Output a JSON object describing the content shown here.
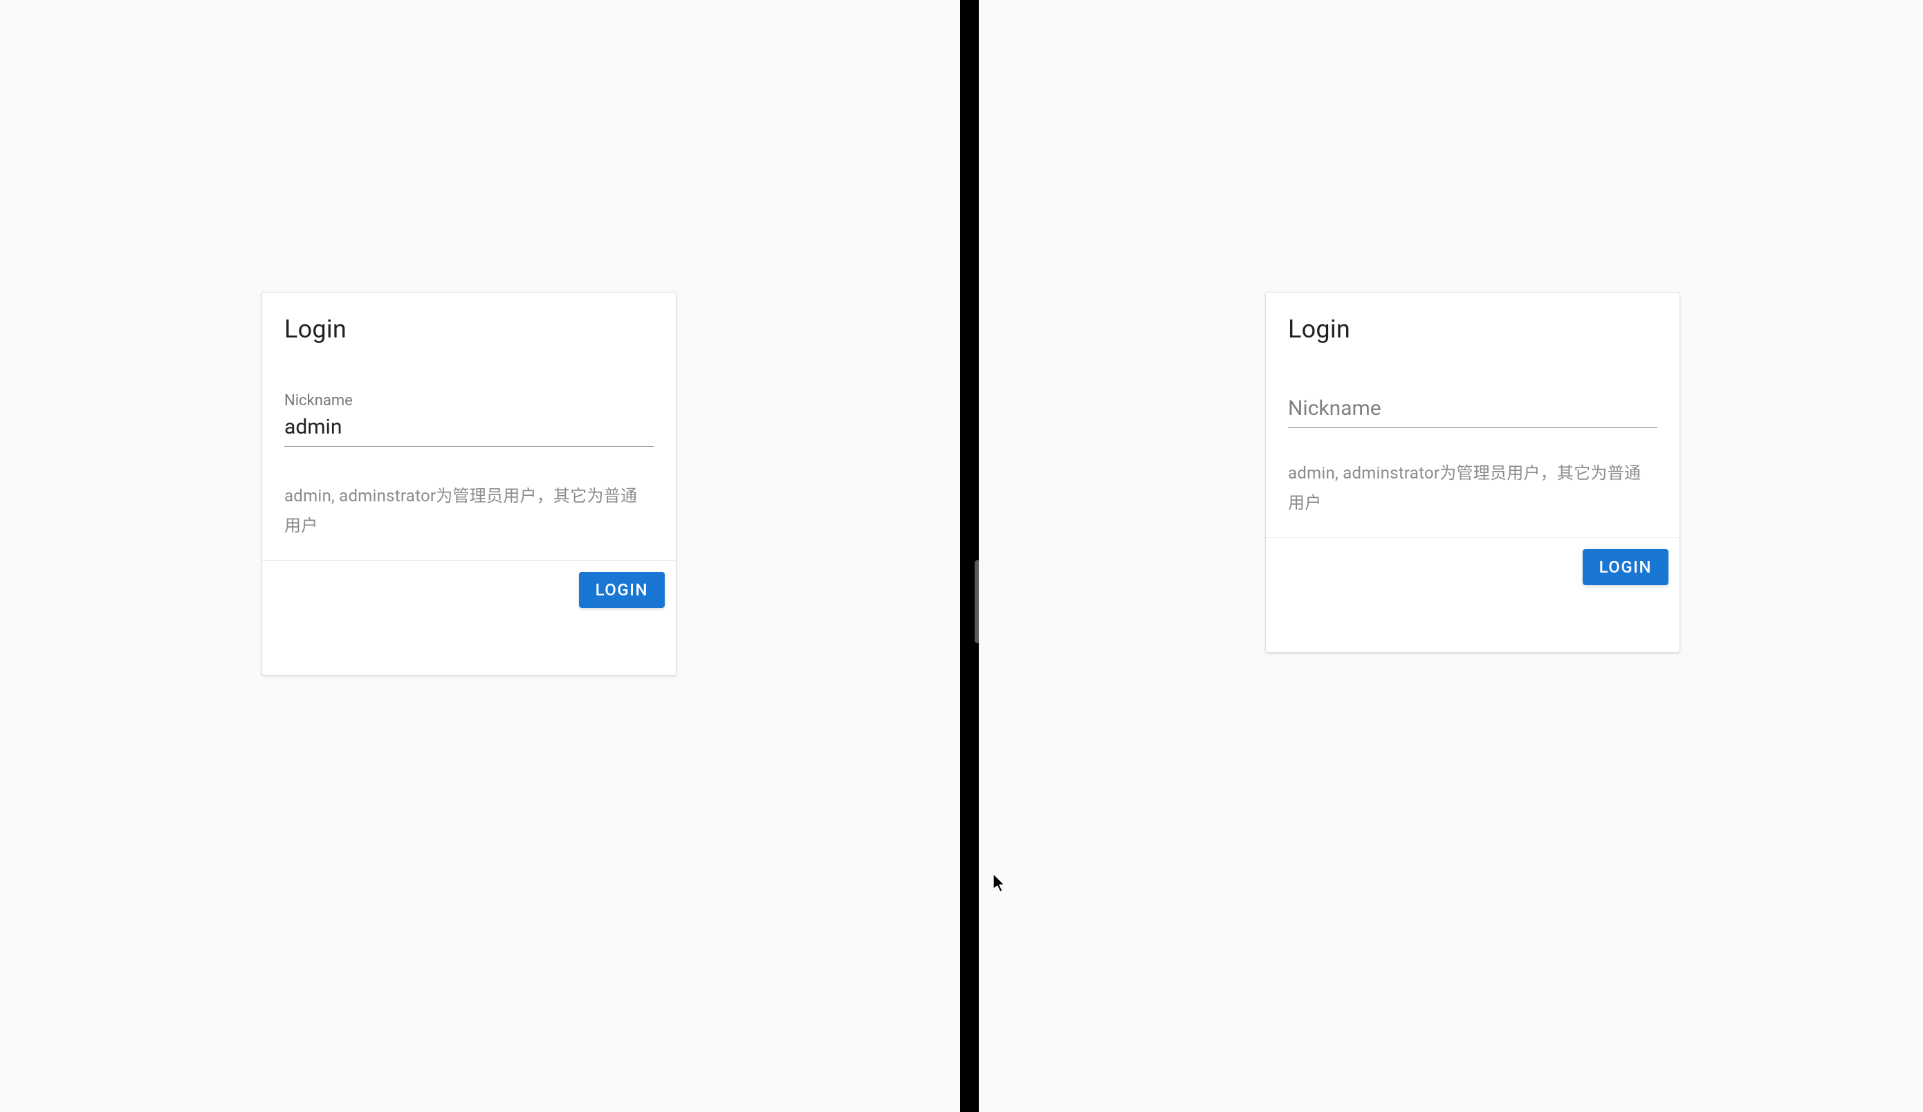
{
  "left": {
    "title": "Login",
    "field": {
      "label": "Nickname",
      "value": "admin"
    },
    "helper": "admin, adminstrator为管理员用户，其它为普通用户",
    "button": "LOGIN"
  },
  "right": {
    "title": "Login",
    "field": {
      "label": "Nickname",
      "value": ""
    },
    "helper": "admin, adminstrator为管理员用户，其它为普通用户",
    "button": "LOGIN"
  }
}
